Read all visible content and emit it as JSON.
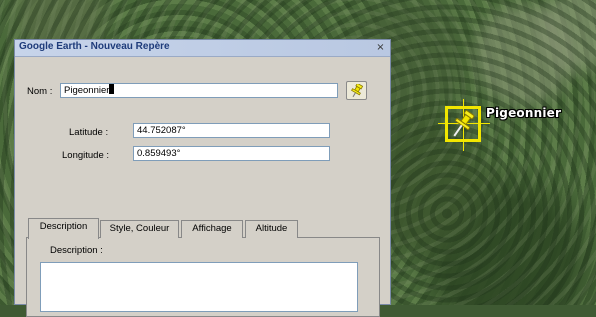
{
  "map": {
    "placemark_label": "Pigeonnier",
    "placemark_color": "#f2e600"
  },
  "dialog": {
    "title": "Google Earth - Nouveau Repère",
    "close_glyph": "×",
    "name_label": "Nom :",
    "name_value": "Pigeonnier",
    "latitude_label": "Latitude :",
    "latitude_value": "44.752087°",
    "longitude_label": "Longitude :",
    "longitude_value": "0.859493°",
    "icon_button": "pushpin-icon",
    "tabs": [
      {
        "label": "Description"
      },
      {
        "label": "Style, Couleur"
      },
      {
        "label": "Affichage"
      },
      {
        "label": "Altitude"
      }
    ],
    "active_tab": "Description",
    "description_label": "Description :",
    "description_value": ""
  }
}
